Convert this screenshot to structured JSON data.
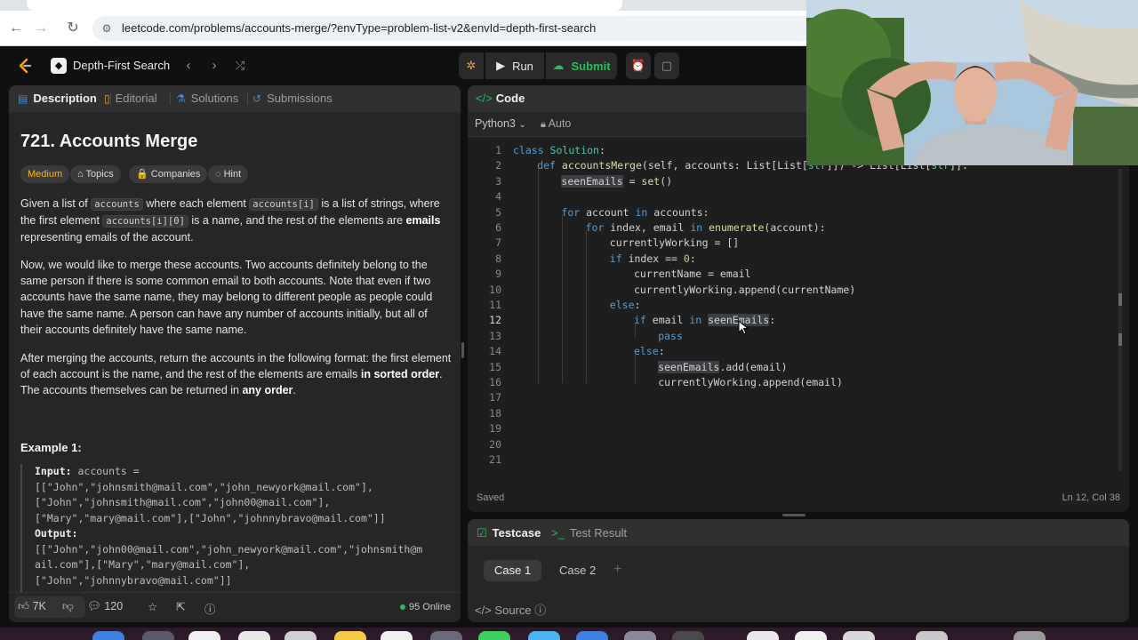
{
  "browser": {
    "url": "leetcode.com/problems/accounts-merge/?envType=problem-list-v2&envId=depth-first-search"
  },
  "topnav": {
    "list_title": "Depth-First Search",
    "run_label": "Run",
    "submit_label": "Submit"
  },
  "left_tabs": {
    "description": "Description",
    "editorial": "Editorial",
    "solutions": "Solutions",
    "submissions": "Submissions"
  },
  "problem": {
    "title": "721. Accounts Merge",
    "difficulty": "Medium",
    "topics": "Topics",
    "companies": "Companies",
    "hint": "Hint",
    "p1_a": "Given a list of ",
    "p1_code1": "accounts",
    "p1_b": " where each element ",
    "p1_code2": "accounts[i]",
    "p1_c": " is a list of strings, where the first element ",
    "p1_code3": "accounts[i][0]",
    "p1_d": " is a name, and the rest of the elements are ",
    "p1_bold": "emails",
    "p1_e": " representing emails of the account.",
    "p2": "Now, we would like to merge these accounts. Two accounts definitely belong to the same person if there is some common email to both accounts. Note that even if two accounts have the same name, they may belong to different people as people could have the same name. A person can have any number of accounts initially, but all of their accounts definitely have the same name.",
    "p3_a": "After merging the accounts, return the accounts in the following format: the first element of each account is the name, and the rest of the elements are emails ",
    "p3_bold1": "in sorted order",
    "p3_b": ". The accounts themselves can be returned in ",
    "p3_bold2": "any order",
    "p3_c": ".",
    "example_title": "Example 1:",
    "input_label": "Input:",
    "input_first": " accounts =",
    "input_lines": [
      "[[\"John\",\"johnsmith@mail.com\",\"john_newyork@mail.com\"],",
      "[\"John\",\"johnsmith@mail.com\",\"john00@mail.com\"],",
      "[\"Mary\",\"mary@mail.com\"],[\"John\",\"johnnybravo@mail.com\"]]"
    ],
    "output_label": "Output:",
    "output_lines": [
      "[[\"John\",\"john00@mail.com\",\"john_newyork@mail.com\",\"johnsmith@m",
      "ail.com\"],[\"Mary\",\"mary@mail.com\"],",
      "[\"John\",\"johnnybravo@mail.com\"]]"
    ]
  },
  "left_footer": {
    "likes": "7K",
    "comments": "120",
    "online": "95 Online"
  },
  "editor": {
    "title": "Code",
    "language": "Python3",
    "auto": "Auto",
    "saved": "Saved",
    "cursor_pos": "Ln 12, Col 38",
    "current_line": 12,
    "line_numbers": [
      "1",
      "2",
      "3",
      "4",
      "5",
      "6",
      "7",
      "8",
      "9",
      "10",
      "11",
      "12",
      "13",
      "14",
      "15",
      "16",
      "17",
      "18",
      "19",
      "20",
      "21"
    ]
  },
  "test": {
    "testcase_tab": "Testcase",
    "result_tab": "Test Result",
    "case1": "Case 1",
    "case2": "Case 2",
    "source": "Source"
  },
  "colors": {
    "accent_orange": "#ffa116",
    "accent_green": "#2cbb5d",
    "difficulty_medium": "#ffb800"
  }
}
